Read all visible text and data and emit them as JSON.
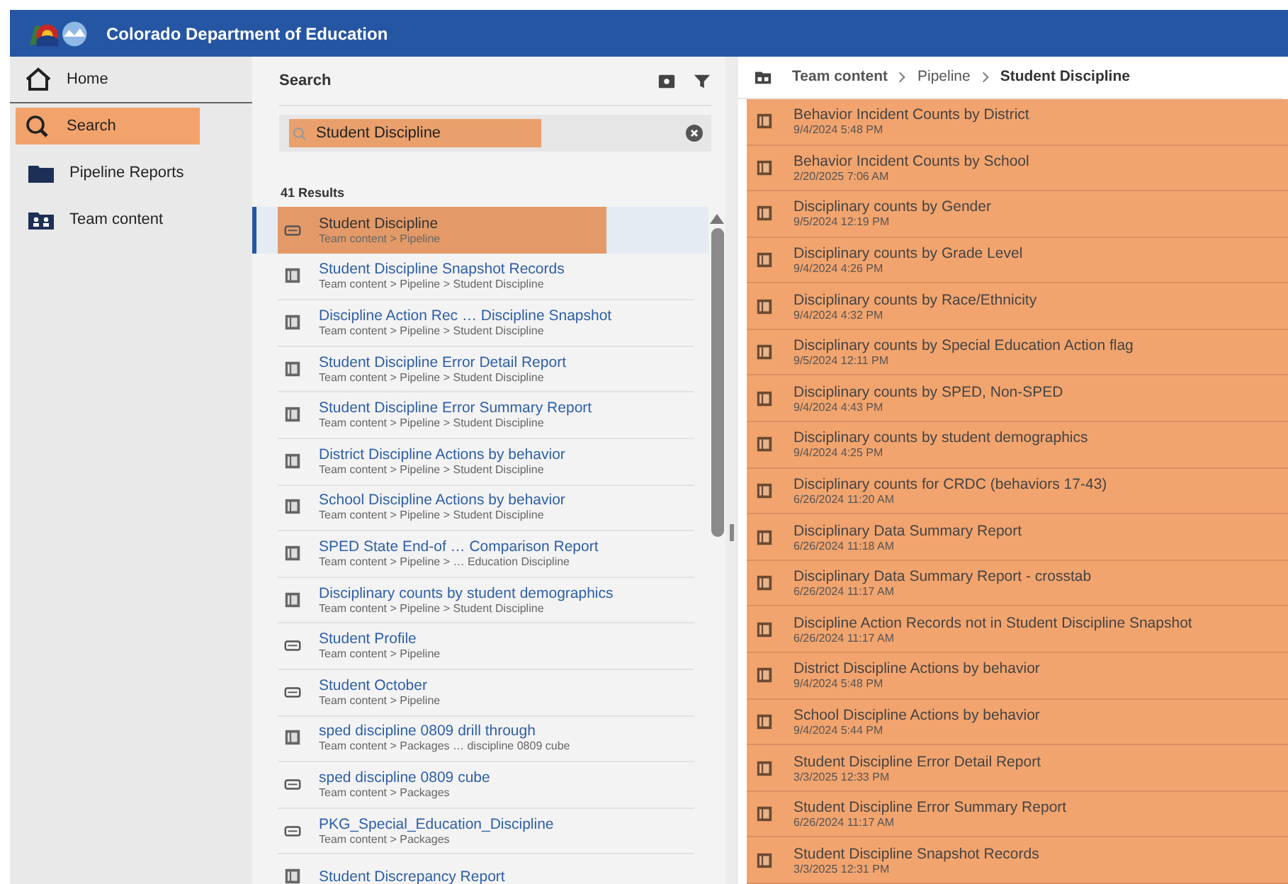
{
  "header": {
    "title": "Colorado Department of Education"
  },
  "nav": [
    {
      "label": "Home",
      "kind": "home",
      "selected": false
    },
    {
      "label": "Search",
      "kind": "search",
      "selected": true
    },
    {
      "label": "Pipeline Reports",
      "kind": "folder",
      "selected": false
    },
    {
      "label": "Team content",
      "kind": "team",
      "selected": false
    }
  ],
  "search": {
    "title": "Search",
    "value": "Student Discipline",
    "count": "41 Results"
  },
  "results": [
    {
      "title": "Student Discipline",
      "path": "Team content > Pipeline",
      "kind": "package",
      "selected": true
    },
    {
      "title": "Student Discipline Snapshot Records",
      "path": "Team content > Pipeline > Student Discipline",
      "kind": "report",
      "selected": false
    },
    {
      "title": "Discipline Action Rec … Discipline Snapshot",
      "path": "Team content > Pipeline > Student Discipline",
      "kind": "report",
      "selected": false
    },
    {
      "title": "Student Discipline Error Detail Report",
      "path": "Team content > Pipeline > Student Discipline",
      "kind": "report",
      "selected": false
    },
    {
      "title": "Student Discipline Error Summary Report",
      "path": "Team content > Pipeline > Student Discipline",
      "kind": "report",
      "selected": false
    },
    {
      "title": "District Discipline Actions by behavior",
      "path": "Team content > Pipeline > Student Discipline",
      "kind": "report",
      "selected": false
    },
    {
      "title": "School Discipline Actions by behavior",
      "path": "Team content > Pipeline > Student Discipline",
      "kind": "report",
      "selected": false
    },
    {
      "title": "SPED State End-of … Comparison Report",
      "path": "Team content > Pipeline > … Education Discipline",
      "kind": "report",
      "selected": false
    },
    {
      "title": "Disciplinary counts by student demographics",
      "path": "Team content > Pipeline > Student Discipline",
      "kind": "report",
      "selected": false
    },
    {
      "title": "Student Profile",
      "path": "Team content > Pipeline",
      "kind": "package",
      "selected": false
    },
    {
      "title": "Student October",
      "path": "Team content > Pipeline",
      "kind": "package",
      "selected": false
    },
    {
      "title": "sped discipline 0809 drill through",
      "path": "Team content > Packages … discipline 0809 cube",
      "kind": "report",
      "selected": false
    },
    {
      "title": "sped discipline 0809 cube",
      "path": "Team content > Packages",
      "kind": "package",
      "selected": false
    },
    {
      "title": "PKG_Special_Education_Discipline",
      "path": "Team content > Packages",
      "kind": "package",
      "selected": false
    },
    {
      "title": "Student Discrepancy Report",
      "kind": "report",
      "selected": false
    }
  ],
  "breadcrumb": [
    {
      "label": "Team content",
      "current": false
    },
    {
      "label": "Pipeline",
      "current": false
    },
    {
      "label": "Student Discipline",
      "current": true
    }
  ],
  "folder_items": [
    {
      "title": "Behavior Incident Counts by District",
      "date": "9/4/2024 5:48 PM"
    },
    {
      "title": "Behavior Incident Counts by School",
      "date": "2/20/2025 7:06 AM"
    },
    {
      "title": "Disciplinary counts by Gender",
      "date": "9/5/2024 12:19 PM"
    },
    {
      "title": "Disciplinary counts by Grade Level",
      "date": "9/4/2024 4:26 PM"
    },
    {
      "title": "Disciplinary counts by Race/Ethnicity",
      "date": "9/4/2024 4:32 PM"
    },
    {
      "title": "Disciplinary counts by Special Education Action flag",
      "date": "9/5/2024 12:11 PM"
    },
    {
      "title": "Disciplinary counts by SPED, Non-SPED",
      "date": "9/4/2024 4:43 PM"
    },
    {
      "title": "Disciplinary counts by student demographics",
      "date": "9/4/2024 4:25 PM"
    },
    {
      "title": "Disciplinary counts for CRDC (behaviors 17-43)",
      "date": "6/26/2024 11:20 AM"
    },
    {
      "title": "Disciplinary Data Summary Report",
      "date": "6/26/2024 11:18 AM"
    },
    {
      "title": "Disciplinary Data Summary Report - crosstab",
      "date": "6/26/2024 11:17 AM"
    },
    {
      "title": "Discipline Action Records not in Student Discipline Snapshot",
      "date": "6/26/2024 11:17 AM"
    },
    {
      "title": "District Discipline Actions by behavior",
      "date": "9/4/2024 5:48 PM"
    },
    {
      "title": "School Discipline Actions by behavior",
      "date": "9/4/2024 5:44 PM"
    },
    {
      "title": "Student Discipline Error Detail Report",
      "date": "3/3/2025 12:33 PM"
    },
    {
      "title": "Student Discipline Error Summary Report",
      "date": "6/26/2024 11:17 AM"
    },
    {
      "title": "Student Discipline Snapshot Records",
      "date": "3/3/2025 12:31 PM"
    }
  ]
}
